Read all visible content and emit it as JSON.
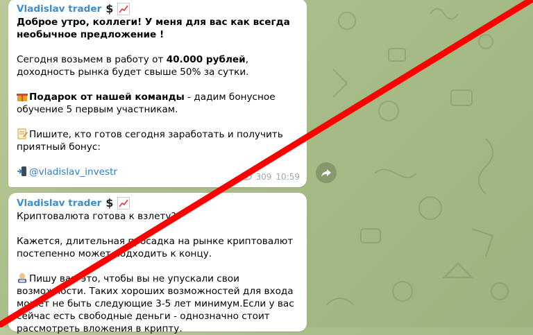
{
  "message1": {
    "sender": "Vladislav trader",
    "sender_symbol": "$",
    "line1": "Доброе утро, коллеги! У меня для вас как всегда необычное предложение !",
    "p2_pre": "Сегодня возьмем в работу от ",
    "p2_bold": "40.000 рублей",
    "p2_post": ", доходность рынка будет свыше 50% за сутки.",
    "p3_bold": "Подарок от нашей команды",
    "p3_post": " - дадим бонусное обучение 5 первым участникам.",
    "p4": "Пишите, кто готов сегодня заработать и получить приятный бонус:",
    "link": "@vladislav_investr",
    "views": "309",
    "time": "10:59"
  },
  "message2": {
    "sender": "Vladislav trader",
    "sender_symbol": "$",
    "p1": "Криптовалюта готова к взлету?",
    "p2": "Кажется, длительная просадка на рынке криптовалют постепенно может подходить к концу.",
    "p3": "Пишу вам это, чтобы вы не упускали свои возможности. Таких хороших возможностей для входа может не быть следующие 3-5 лет минимум.Если у вас сейчас есть свободные деньги - однозначно стоит рассмотреть вложения в крипту."
  },
  "colors": {
    "accent": "#3a8fd0",
    "link": "#2a7fd0",
    "strike": "#ff0000"
  },
  "icons": [
    "chart-up-icon",
    "gift-icon",
    "memo-icon",
    "phone-arrow-icon",
    "eye-icon",
    "share-icon",
    "technologist-icon"
  ]
}
